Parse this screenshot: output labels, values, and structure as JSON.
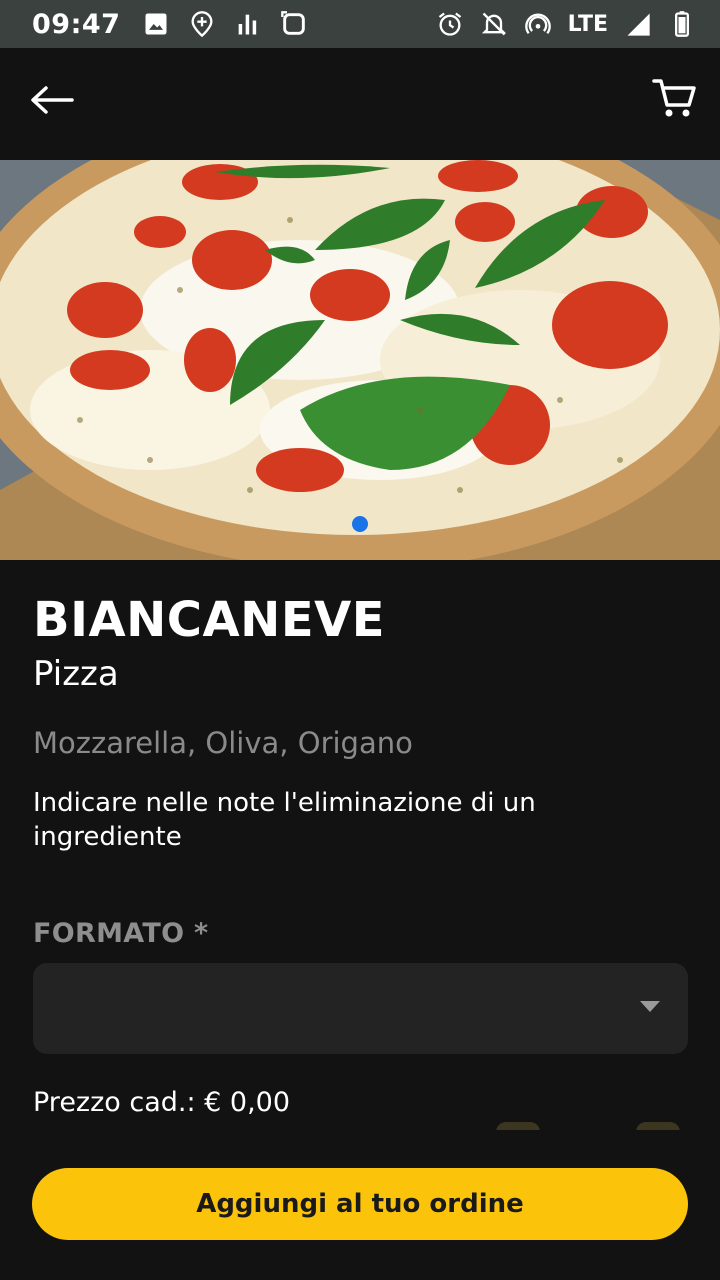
{
  "status_bar": {
    "time": "09:47",
    "network": "LTE",
    "left_icons": [
      "image-icon",
      "location-plus-icon",
      "signal-bars-icon",
      "screenshot-icon"
    ],
    "right_icons": [
      "alarm-icon",
      "notifications-off-icon",
      "hotspot-icon",
      "cell-signal-icon",
      "battery-icon"
    ]
  },
  "app_bar": {
    "back_icon": "arrow-left-icon",
    "cart_icon": "cart-icon"
  },
  "product": {
    "name": "BIANCANEVE",
    "category": "Pizza",
    "ingredients": "Mozzarella, Oliva, Origano",
    "note": "Indicare nelle note l'eliminazione di un ingrediente",
    "format_label": "FORMATO *",
    "format_selected": "",
    "price_text": "Prezzo cad.: € 0,00"
  },
  "carousel": {
    "active_index": 0,
    "count": 1
  },
  "actions": {
    "add_label": "Aggiungi al tuo ordine"
  },
  "colors": {
    "accent": "#fcc30b",
    "background": "#121212",
    "dot": "#1a73e8"
  }
}
